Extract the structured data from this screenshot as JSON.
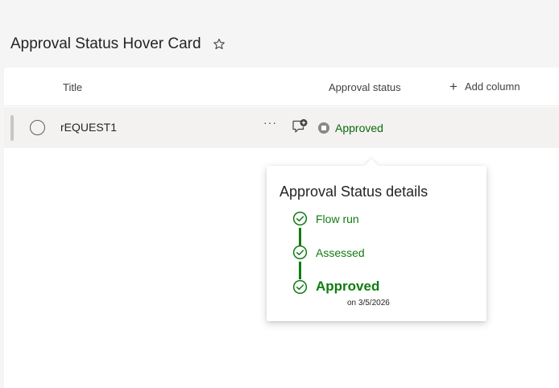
{
  "page": {
    "title": "Approval Status Hover Card"
  },
  "columns": {
    "title": "Title",
    "approval": "Approval status",
    "add": "Add column"
  },
  "row": {
    "title": "rEQUEST1",
    "more": "···",
    "status": "Approved"
  },
  "hovercard": {
    "title": "Approval Status details",
    "steps": [
      {
        "label": "Flow run"
      },
      {
        "label": "Assessed"
      },
      {
        "label": "Approved",
        "sub": "on 3/5/2026"
      }
    ]
  },
  "colors": {
    "status_green": "#107c10",
    "status_text_green": "#0b6a0b",
    "status_dot_gray": "#8a8886"
  },
  "icons": [
    "star-icon",
    "plus-icon",
    "more-icon",
    "comment-add-icon",
    "status-dot-icon",
    "check-circle-icon"
  ]
}
